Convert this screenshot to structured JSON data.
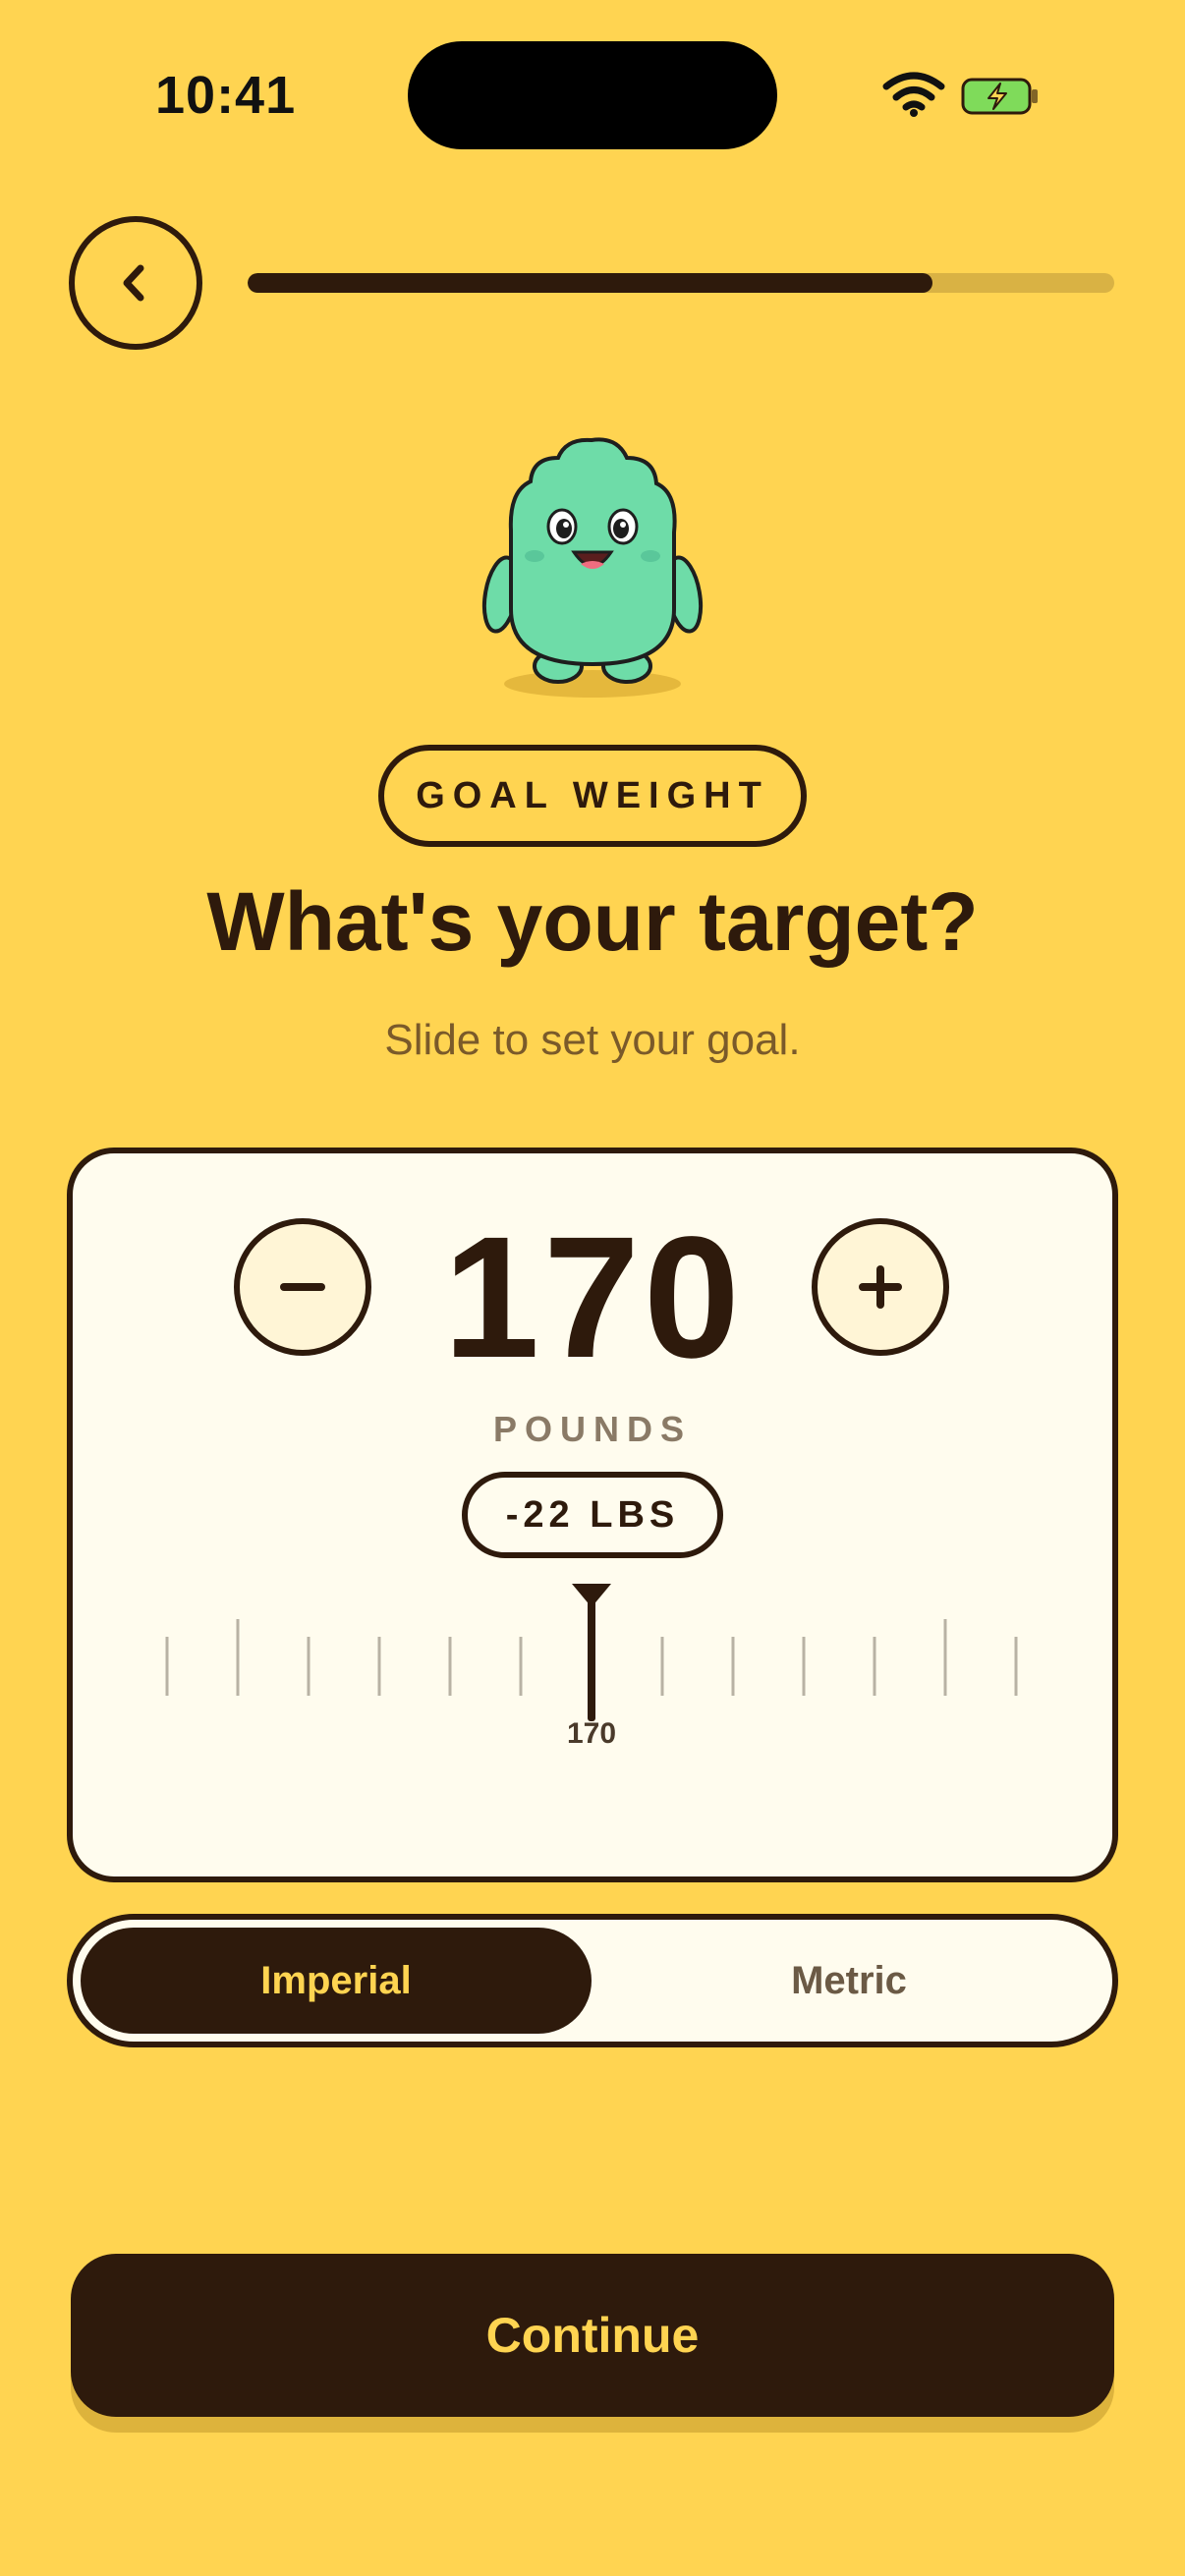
{
  "status_bar": {
    "time": "10:41"
  },
  "progress": {
    "fraction": 0.79
  },
  "header": {
    "back_icon": "chevron-left-icon"
  },
  "pill_label": "GOAL WEIGHT",
  "title": "What's your target?",
  "subtitle": "Slide to set your goal.",
  "weight": {
    "value": "170",
    "unit": "POUNDS",
    "difference": "-22 LBS",
    "ruler_label": "170",
    "minus_symbol": "–",
    "plus_symbol": "+"
  },
  "unit_toggle": {
    "options": [
      "Imperial",
      "Metric"
    ],
    "selected": "Imperial"
  },
  "continue_label": "Continue",
  "colors": {
    "background": "#FFD451",
    "ink": "#2E1A0C",
    "card": "#FFFCEE",
    "mascot": "#6EDCA8"
  }
}
